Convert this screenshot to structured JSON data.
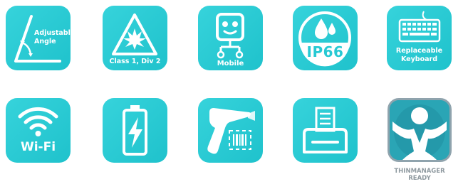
{
  "colors": {
    "tile": "#27c9d3",
    "icon": "#ffffff",
    "tm_border": "#8fa3ad",
    "tm_text": "#8f9aa0"
  },
  "features": [
    {
      "label_line1": "Adjustable",
      "label_line2": "Angle",
      "icon": "protractor-icon"
    },
    {
      "label": "Class 1, Div 2",
      "icon": "explosion-warning-icon"
    },
    {
      "label": "Mobile",
      "icon": "robot-icon"
    },
    {
      "label": "IP66",
      "icon": "water-drops-icon"
    },
    {
      "label_line1": "Replaceable",
      "label_line2": "Keyboard",
      "icon": "keyboard-icon"
    },
    {
      "label": "Wi-Fi",
      "icon": "wifi-icon"
    },
    {
      "label": "",
      "icon": "battery-charging-icon"
    },
    {
      "label": "",
      "icon": "barcode-scanner-icon"
    },
    {
      "label": "",
      "icon": "printer-icon"
    },
    {
      "label_line1": "THINMANAGER",
      "label_line2": "READY",
      "icon": "thinmanager-logo-icon"
    }
  ]
}
